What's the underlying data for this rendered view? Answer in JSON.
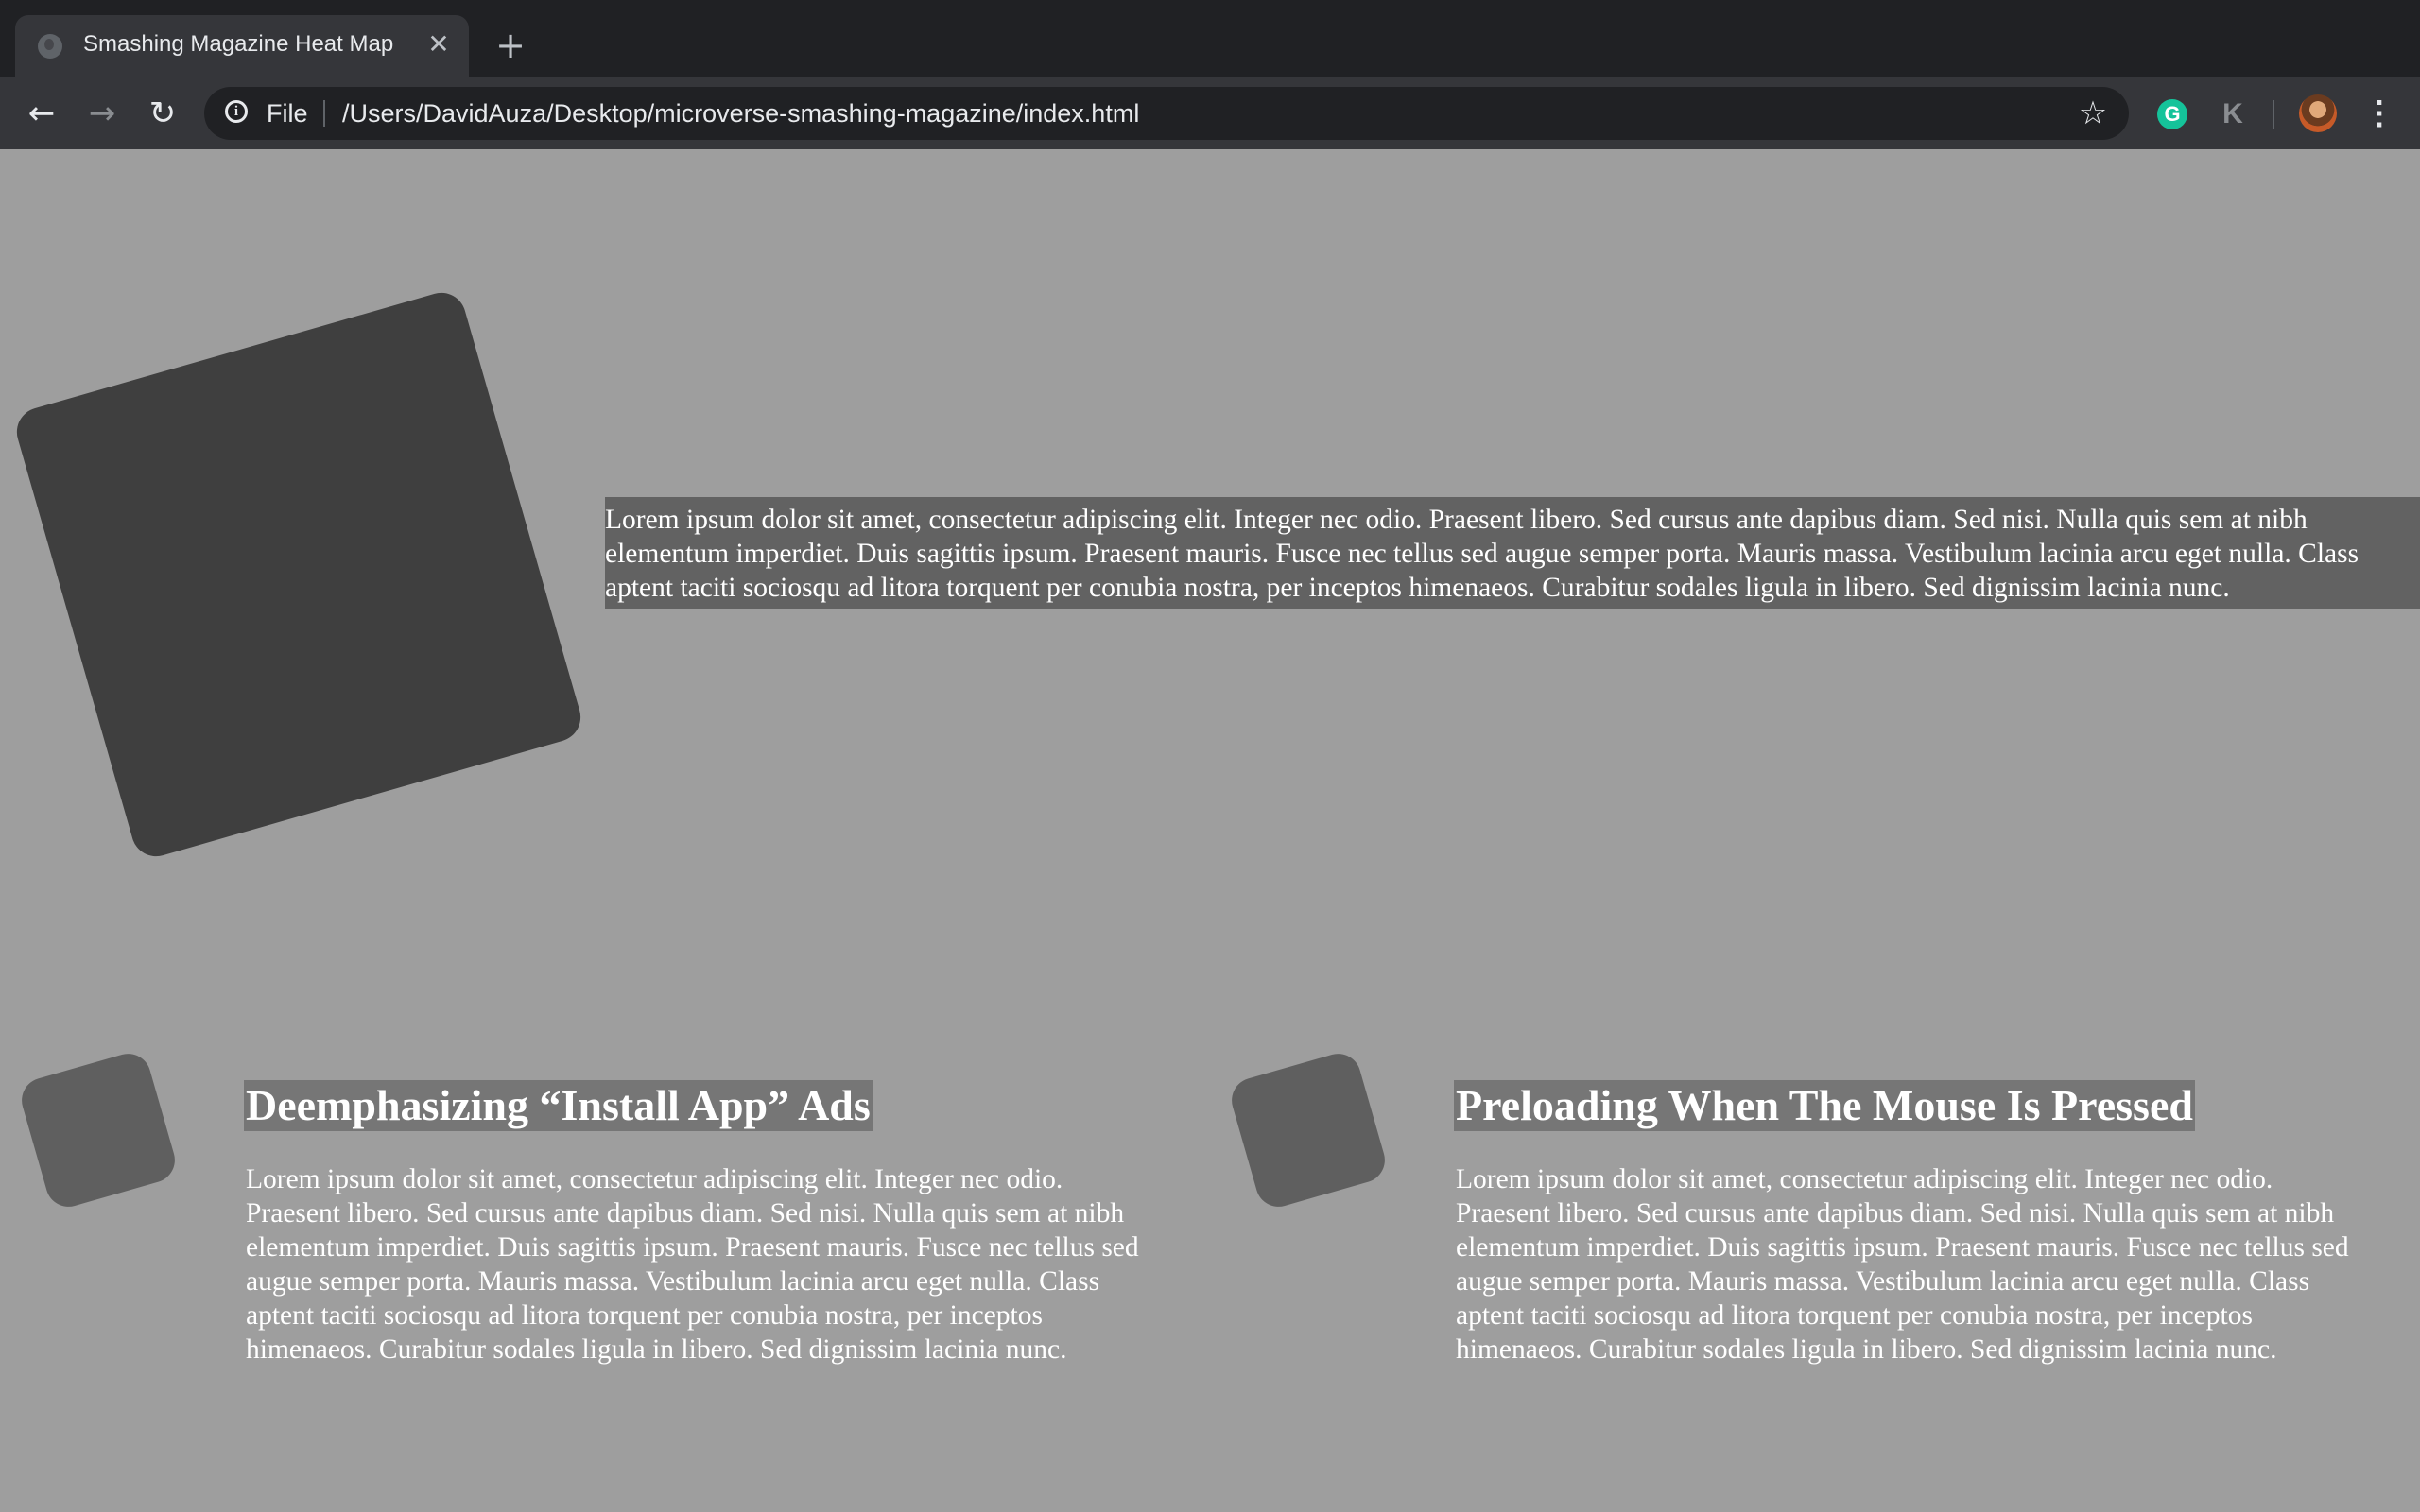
{
  "browser": {
    "tab_title": "Smashing Magazine Heat Map",
    "tab_close_glyph": "✕",
    "new_tab_glyph": "+",
    "back_glyph": "←",
    "forward_glyph": "→",
    "reload_glyph": "↻",
    "info_glyph": "i",
    "scheme_label": "File",
    "url": "/Users/DavidAuza/Desktop/microverse-smashing-magazine/index.html",
    "star_glyph": "☆",
    "grammarly_glyph": "G",
    "extension_glyph": "K",
    "menu_glyph": "⋮",
    "icons": [
      "globe-favicon-icon",
      "close-icon",
      "plus-icon",
      "back-arrow-icon",
      "forward-arrow-icon",
      "reload-icon",
      "info-icon",
      "star-icon",
      "grammarly-icon",
      "extension-icon",
      "avatar",
      "kebab-menu-icon"
    ],
    "colors": {
      "tab_strip": "#202124",
      "toolbar": "#35363a",
      "omnibox": "#202124",
      "grammarly": "#15c39a"
    }
  },
  "page": {
    "background": "#9e9e9e",
    "hero": {
      "text": "Lorem ipsum dolor sit amet, consectetur adipiscing elit. Integer nec odio. Praesent libero. Sed cursus ante dapibus diam. Sed nisi. Nulla quis sem at nibh elementum imperdiet. Duis sagittis ipsum. Praesent mauris. Fusce nec tellus sed augue semper porta. Mauris massa. Vestibulum lacinia arcu eget nulla. Class aptent taciti sociosqu ad litora torquent per conubia nostra, per inceptos himenaeos. Curabitur sodales ligula in libero. Sed dignissim lacinia nunc."
    },
    "cards": [
      {
        "title": "Deemphasizing “Install App” Ads",
        "body": "Lorem ipsum dolor sit amet, consectetur adipiscing elit. Integer nec odio. Praesent libero. Sed cursus ante dapibus diam. Sed nisi. Nulla quis sem at nibh elementum imperdiet. Duis sagittis ipsum. Praesent mauris. Fusce nec tellus sed augue semper porta. Mauris massa. Vestibulum lacinia arcu eget nulla. Class aptent taciti sociosqu ad litora torquent per conubia nostra, per inceptos himenaeos. Curabitur sodales ligula in libero. Sed dignissim lacinia nunc."
      },
      {
        "title": "Preloading When The Mouse Is Pressed",
        "body": "Lorem ipsum dolor sit amet, consectetur adipiscing elit. Integer nec odio. Praesent libero. Sed cursus ante dapibus diam. Sed nisi. Nulla quis sem at nibh elementum imperdiet. Duis sagittis ipsum. Praesent mauris. Fusce nec tellus sed augue semper porta. Mauris massa. Vestibulum lacinia arcu eget nulla. Class aptent taciti sociosqu ad litora torquent per conubia nostra, per inceptos himenaeos. Curabitur sodales ligula in libero. Sed dignissim lacinia nunc."
      }
    ],
    "colors": {
      "hero_square": "#3f3f3f",
      "hero_text_highlight": "#626262",
      "card_square": "#5f5f5f",
      "card_title_highlight": "#767676",
      "text": "#ffffff"
    }
  }
}
